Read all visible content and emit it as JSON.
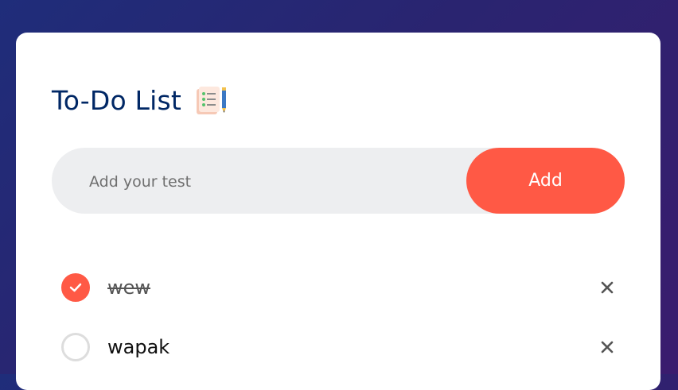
{
  "app": {
    "title": "To-Do List",
    "title_icon": "notepad-pencil-icon"
  },
  "input": {
    "placeholder": "Add your test",
    "value": ""
  },
  "add_button": {
    "label": "Add"
  },
  "colors": {
    "accent": "#ff5945",
    "title": "#002765",
    "input_bg": "#edeef0",
    "background_start": "#1f2d7a",
    "background_end": "#3a1c6e"
  },
  "tasks": [
    {
      "text": "wew",
      "checked": true,
      "delete_icon": "close-icon"
    },
    {
      "text": "wapak",
      "checked": false,
      "delete_icon": "close-icon"
    }
  ]
}
